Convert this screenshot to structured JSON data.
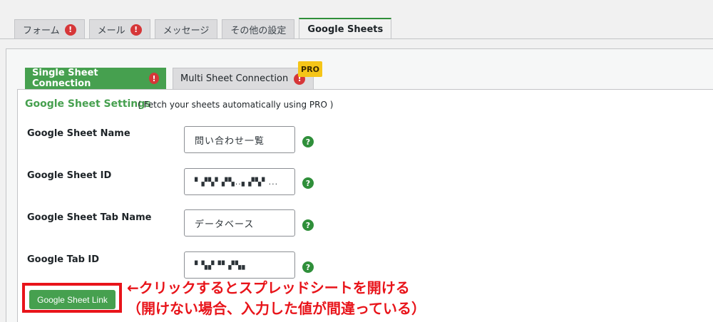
{
  "top_tabs": [
    {
      "label": "フォーム",
      "alert": true
    },
    {
      "label": "メール",
      "alert": true
    },
    {
      "label": "メッセージ",
      "alert": false
    },
    {
      "label": "その他の設定",
      "alert": false
    },
    {
      "label": "Google Sheets",
      "alert": false,
      "active": true
    }
  ],
  "alert_glyph": "!",
  "sub_tabs": {
    "single": "Single Sheet Connection",
    "multi": "Multi Sheet Connection",
    "pro_badge": "PRO"
  },
  "settings": {
    "title": "Google Sheet Settings",
    "note": "( Fetch your sheets automatically using PRO )",
    "help_glyph": "?"
  },
  "fields": [
    {
      "label": "Google Sheet Name",
      "value": "問い合わせ一覧"
    },
    {
      "label": "Google Sheet ID",
      "value": "▘▞▚▘▞▚..▖▞▚▘..."
    },
    {
      "label": "Google Sheet Tab Name",
      "value": "データベース"
    },
    {
      "label": "Google Tab ID",
      "value": "▘▚▞▝▘▞▚▖"
    }
  ],
  "link_button": "Google Sheet Link",
  "annotation": {
    "line1": "←クリックするとスプレッドシートを開ける",
    "line2": "（開けない場合、入力した値が間違っている）"
  },
  "colors": {
    "accent": "#46a04f",
    "alert": "#d63638",
    "annotation": "#e8141a",
    "pro": "#f5c518"
  }
}
